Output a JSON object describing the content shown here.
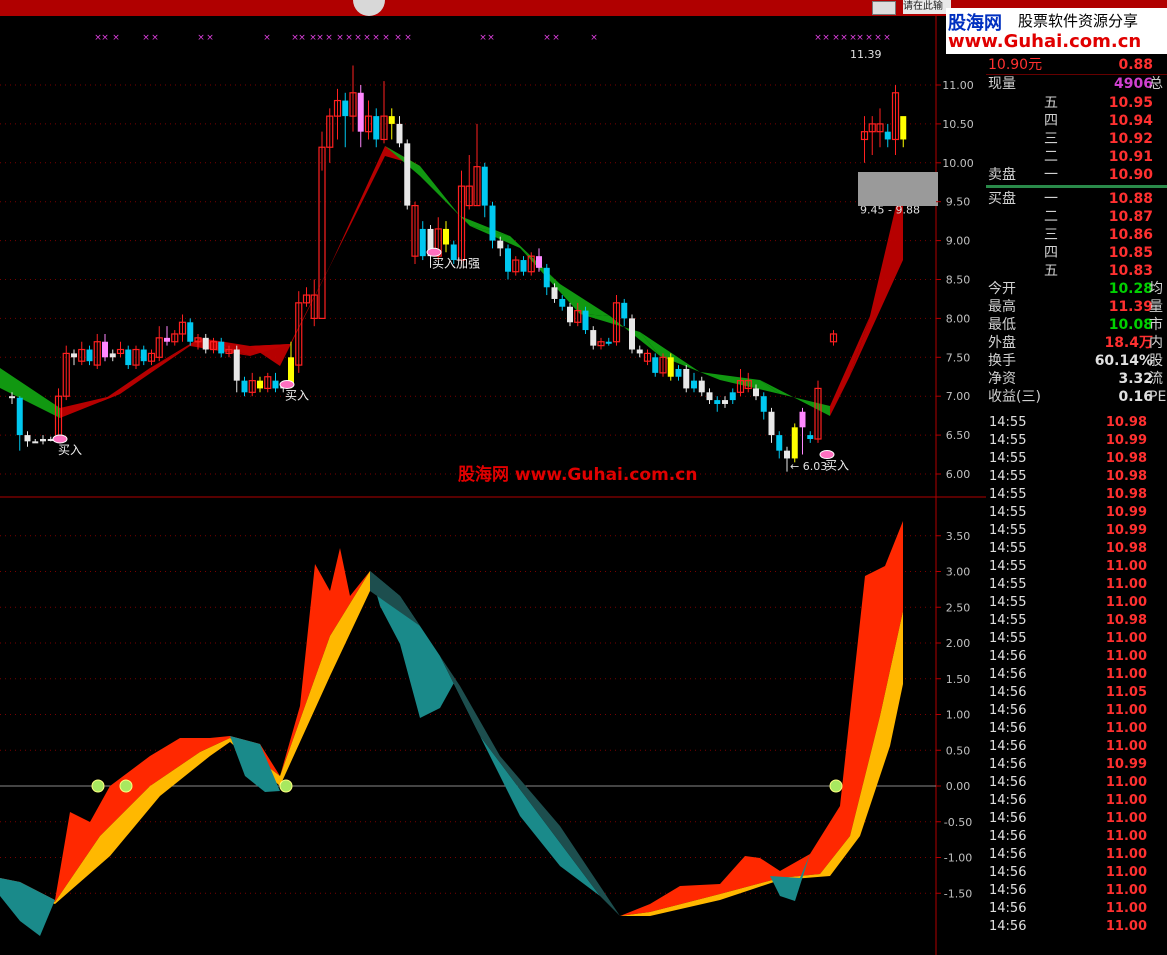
{
  "toolbar": {
    "input_text": "请在此输"
  },
  "logo": {
    "name": "股海网",
    "slogan": "股票软件资源分享",
    "url": "www.Guhai.com.cn"
  },
  "watermark": {
    "name": "股海网",
    "url": "www.Guhai.com.cn"
  },
  "quote": {
    "top_price": "10.90元",
    "top_change": "0.88",
    "volume_label": "现量",
    "volume_value": "4906",
    "volume_ext": "总",
    "sell_label": "卖盘",
    "buy_label": "买盘",
    "sell_levels": [
      {
        "label": "五",
        "price": "10.95"
      },
      {
        "label": "四",
        "price": "10.94"
      },
      {
        "label": "三",
        "price": "10.92"
      },
      {
        "label": "二",
        "price": "10.91"
      },
      {
        "label": "一",
        "price": "10.90"
      }
    ],
    "buy_levels": [
      {
        "label": "一",
        "price": "10.88"
      },
      {
        "label": "二",
        "price": "10.87"
      },
      {
        "label": "三",
        "price": "10.86"
      },
      {
        "label": "四",
        "price": "10.85"
      },
      {
        "label": "五",
        "price": "10.83"
      }
    ],
    "stats": [
      {
        "label": "今开",
        "value": "10.28",
        "cls": "green",
        "ext": "均"
      },
      {
        "label": "最高",
        "value": "11.39",
        "cls": "red",
        "ext": "量"
      },
      {
        "label": "最低",
        "value": "10.08",
        "cls": "green",
        "ext": "市"
      },
      {
        "label": "外盘",
        "value": "18.4万",
        "cls": "red",
        "ext": "内"
      },
      {
        "label": "换手",
        "value": "60.14%",
        "cls": "white",
        "ext": "股"
      },
      {
        "label": "净资",
        "value": "3.32",
        "cls": "white",
        "ext": "流"
      },
      {
        "label": "收益(三)",
        "value": "0.16",
        "cls": "white",
        "ext": "PE"
      }
    ],
    "ticks": [
      {
        "time": "14:55",
        "price": "10.98"
      },
      {
        "time": "14:55",
        "price": "10.99"
      },
      {
        "time": "14:55",
        "price": "10.98"
      },
      {
        "time": "14:55",
        "price": "10.98"
      },
      {
        "time": "14:55",
        "price": "10.98"
      },
      {
        "time": "14:55",
        "price": "10.99"
      },
      {
        "time": "14:55",
        "price": "10.99"
      },
      {
        "time": "14:55",
        "price": "10.98"
      },
      {
        "time": "14:55",
        "price": "11.00"
      },
      {
        "time": "14:55",
        "price": "11.00"
      },
      {
        "time": "14:55",
        "price": "11.00"
      },
      {
        "time": "14:55",
        "price": "10.98"
      },
      {
        "time": "14:55",
        "price": "11.00"
      },
      {
        "time": "14:56",
        "price": "11.00"
      },
      {
        "time": "14:56",
        "price": "11.00"
      },
      {
        "time": "14:56",
        "price": "11.05"
      },
      {
        "time": "14:56",
        "price": "11.00"
      },
      {
        "time": "14:56",
        "price": "11.00"
      },
      {
        "time": "14:56",
        "price": "11.00"
      },
      {
        "time": "14:56",
        "price": "10.99"
      },
      {
        "time": "14:56",
        "price": "11.00"
      },
      {
        "time": "14:56",
        "price": "11.00"
      },
      {
        "time": "14:56",
        "price": "11.00"
      },
      {
        "time": "14:56",
        "price": "11.00"
      },
      {
        "time": "14:56",
        "price": "11.00"
      },
      {
        "time": "14:56",
        "price": "11.00"
      },
      {
        "time": "14:56",
        "price": "11.00"
      },
      {
        "time": "14:56",
        "price": "11.00"
      },
      {
        "time": "14:56",
        "price": "11.00"
      }
    ]
  },
  "chart_data": [
    {
      "type": "candlestick",
      "ylim": [
        5.8,
        11.4
      ],
      "yticks": [
        "11.00",
        "10.50",
        "10.00",
        "9.50",
        "9.00",
        "8.50",
        "8.00",
        "7.50",
        "7.00",
        "6.50",
        "6.00"
      ],
      "candles": [
        [
          7.0,
          6.98,
          7.05,
          6.9,
          "w"
        ],
        [
          6.98,
          6.5,
          7.0,
          6.3,
          "c"
        ],
        [
          6.5,
          6.42,
          6.55,
          6.35,
          "w"
        ],
        [
          6.42,
          6.42,
          6.45,
          6.4,
          "w"
        ],
        [
          6.42,
          6.45,
          6.5,
          6.38,
          "w"
        ],
        [
          6.45,
          6.45,
          6.48,
          6.42,
          "w"
        ],
        [
          6.42,
          7.0,
          7.1,
          6.4,
          "r"
        ],
        [
          7.0,
          7.55,
          7.65,
          6.95,
          "r"
        ],
        [
          7.55,
          7.5,
          7.6,
          7.4,
          "w"
        ],
        [
          7.45,
          7.6,
          7.7,
          7.4,
          "r"
        ],
        [
          7.6,
          7.45,
          7.65,
          7.4,
          "c"
        ],
        [
          7.4,
          7.7,
          7.8,
          7.35,
          "r"
        ],
        [
          7.7,
          7.5,
          7.8,
          7.45,
          "p"
        ],
        [
          7.5,
          7.55,
          7.6,
          7.45,
          "w"
        ],
        [
          7.55,
          7.6,
          7.7,
          7.5,
          "r"
        ],
        [
          7.6,
          7.4,
          7.65,
          7.35,
          "c"
        ],
        [
          7.4,
          7.6,
          7.65,
          7.35,
          "r"
        ],
        [
          7.6,
          7.45,
          7.65,
          7.4,
          "c"
        ],
        [
          7.45,
          7.55,
          7.6,
          7.4,
          "r"
        ],
        [
          7.5,
          7.75,
          7.9,
          7.45,
          "r"
        ],
        [
          7.75,
          7.7,
          7.9,
          7.65,
          "p"
        ],
        [
          7.7,
          7.8,
          7.85,
          7.65,
          "r"
        ],
        [
          7.8,
          7.95,
          8.05,
          7.7,
          "r"
        ],
        [
          7.95,
          7.7,
          8.0,
          7.65,
          "c"
        ],
        [
          7.7,
          7.75,
          7.8,
          7.6,
          "r"
        ],
        [
          7.75,
          7.6,
          7.8,
          7.55,
          "w"
        ],
        [
          7.6,
          7.7,
          7.75,
          7.55,
          "r"
        ],
        [
          7.7,
          7.55,
          7.75,
          7.5,
          "c"
        ],
        [
          7.55,
          7.6,
          7.65,
          7.5,
          "r"
        ],
        [
          7.6,
          7.2,
          7.65,
          7.05,
          "w"
        ],
        [
          7.2,
          7.05,
          7.25,
          7.0,
          "c"
        ],
        [
          7.05,
          7.2,
          7.3,
          7.0,
          "r"
        ],
        [
          7.2,
          7.1,
          7.25,
          7.05,
          "y"
        ],
        [
          7.1,
          7.25,
          7.3,
          7.05,
          "r"
        ],
        [
          7.2,
          7.1,
          7.3,
          7.05,
          "c"
        ],
        [
          7.1,
          7.15,
          7.2,
          7.05,
          "w"
        ],
        [
          7.15,
          7.5,
          7.7,
          7.1,
          "y"
        ],
        [
          7.4,
          8.2,
          8.35,
          7.3,
          "r"
        ],
        [
          8.2,
          8.3,
          8.4,
          8.15,
          "r"
        ],
        [
          8.3,
          8.0,
          8.5,
          7.9,
          "r"
        ],
        [
          8.0,
          10.2,
          10.4,
          9.9,
          "r"
        ],
        [
          10.2,
          10.6,
          10.7,
          10.0,
          "r"
        ],
        [
          10.6,
          10.8,
          10.95,
          10.3,
          "r"
        ],
        [
          10.8,
          10.6,
          10.9,
          10.2,
          "c"
        ],
        [
          10.6,
          10.9,
          11.25,
          10.4,
          "r"
        ],
        [
          10.9,
          10.4,
          11.0,
          10.2,
          "p"
        ],
        [
          10.4,
          10.6,
          10.8,
          10.3,
          "r"
        ],
        [
          10.6,
          10.3,
          10.7,
          10.2,
          "c"
        ],
        [
          10.3,
          10.6,
          11.05,
          10.25,
          "r"
        ],
        [
          10.6,
          10.5,
          10.7,
          10.3,
          "y"
        ],
        [
          10.5,
          10.25,
          10.6,
          10.2,
          "w"
        ],
        [
          10.25,
          9.45,
          10.3,
          9.4,
          "w"
        ],
        [
          9.45,
          8.8,
          9.5,
          8.7,
          "r"
        ],
        [
          8.8,
          9.15,
          9.25,
          8.75,
          "c"
        ],
        [
          9.15,
          8.8,
          9.2,
          8.65,
          "w"
        ],
        [
          8.8,
          9.15,
          9.3,
          8.75,
          "r"
        ],
        [
          9.15,
          8.95,
          9.25,
          8.85,
          "y"
        ],
        [
          8.95,
          8.75,
          9.0,
          8.7,
          "c"
        ],
        [
          8.75,
          9.7,
          9.9,
          8.7,
          "r"
        ],
        [
          9.7,
          9.45,
          10.1,
          9.4,
          "r"
        ],
        [
          9.45,
          9.95,
          10.5,
          9.45,
          "r"
        ],
        [
          9.95,
          9.45,
          10.0,
          9.3,
          "c"
        ],
        [
          9.45,
          9.0,
          9.5,
          8.9,
          "c"
        ],
        [
          9.0,
          8.9,
          9.05,
          8.8,
          "w"
        ],
        [
          8.9,
          8.6,
          8.95,
          8.5,
          "c"
        ],
        [
          8.6,
          8.75,
          8.8,
          8.55,
          "r"
        ],
        [
          8.75,
          8.6,
          8.8,
          8.55,
          "c"
        ],
        [
          8.6,
          8.8,
          8.85,
          8.55,
          "r"
        ],
        [
          8.8,
          8.65,
          8.9,
          8.6,
          "p"
        ],
        [
          8.65,
          8.4,
          8.7,
          8.3,
          "c"
        ],
        [
          8.4,
          8.25,
          8.45,
          8.2,
          "w"
        ],
        [
          8.25,
          8.15,
          8.3,
          8.1,
          "c"
        ],
        [
          8.15,
          7.95,
          8.2,
          7.9,
          "w"
        ],
        [
          7.95,
          8.1,
          8.2,
          7.9,
          "r"
        ],
        [
          8.1,
          7.85,
          8.15,
          7.8,
          "c"
        ],
        [
          7.85,
          7.65,
          7.9,
          7.6,
          "w"
        ],
        [
          7.65,
          7.7,
          7.75,
          7.6,
          "r"
        ],
        [
          7.7,
          7.7,
          7.75,
          7.65,
          "c"
        ],
        [
          7.7,
          8.2,
          8.3,
          7.65,
          "r"
        ],
        [
          8.2,
          8.0,
          8.25,
          7.9,
          "c"
        ],
        [
          8.0,
          7.6,
          8.05,
          7.55,
          "w"
        ],
        [
          7.6,
          7.55,
          7.65,
          7.5,
          "w"
        ],
        [
          7.55,
          7.45,
          7.6,
          7.4,
          "r"
        ],
        [
          7.5,
          7.3,
          7.55,
          7.25,
          "c"
        ],
        [
          7.3,
          7.5,
          7.55,
          7.25,
          "r"
        ],
        [
          7.5,
          7.25,
          7.55,
          7.2,
          "y"
        ],
        [
          7.25,
          7.35,
          7.4,
          7.2,
          "c"
        ],
        [
          7.35,
          7.1,
          7.4,
          7.05,
          "w"
        ],
        [
          7.1,
          7.2,
          7.3,
          7.05,
          "c"
        ],
        [
          7.2,
          7.05,
          7.25,
          7.0,
          "w"
        ],
        [
          7.05,
          6.95,
          7.1,
          6.9,
          "w"
        ],
        [
          6.95,
          6.9,
          7.0,
          6.8,
          "c"
        ],
        [
          6.9,
          6.95,
          7.0,
          6.85,
          "w"
        ],
        [
          6.95,
          7.05,
          7.1,
          6.9,
          "c"
        ],
        [
          7.05,
          7.2,
          7.35,
          7.0,
          "r"
        ],
        [
          7.2,
          7.1,
          7.3,
          7.05,
          "r"
        ],
        [
          7.1,
          7.0,
          7.15,
          6.95,
          "w"
        ],
        [
          7.0,
          6.8,
          7.05,
          6.7,
          "c"
        ],
        [
          6.8,
          6.5,
          6.85,
          6.4,
          "w"
        ],
        [
          6.5,
          6.3,
          6.55,
          6.2,
          "c"
        ],
        [
          6.3,
          6.2,
          6.35,
          6.03,
          "w"
        ],
        [
          6.2,
          6.6,
          6.65,
          6.15,
          "y"
        ],
        [
          6.6,
          6.8,
          6.85,
          6.25,
          "p"
        ],
        [
          6.5,
          6.45,
          6.55,
          6.4,
          "c"
        ],
        [
          6.45,
          7.1,
          7.2,
          6.4,
          "r"
        ],
        null,
        [
          7.7,
          7.8,
          7.85,
          7.65,
          "r"
        ],
        null,
        null,
        null,
        [
          10.3,
          10.4,
          10.6,
          10.0,
          "r"
        ],
        [
          10.4,
          10.5,
          10.6,
          10.1,
          "r"
        ],
        [
          10.5,
          10.4,
          10.7,
          10.2,
          "r"
        ],
        [
          10.4,
          10.3,
          10.5,
          10.2,
          "c"
        ],
        [
          10.3,
          10.9,
          11.0,
          10.1,
          "r"
        ],
        [
          10.6,
          10.3,
          10.5,
          10.2,
          "y"
        ]
      ],
      "markers": [
        {
          "label": "买入",
          "x": 60,
          "y": 6.45
        },
        {
          "label": "买入",
          "x": 287,
          "y": 7.15
        },
        {
          "label": "买入加强",
          "x": 434,
          "y": 8.85
        },
        {
          "label": "买入",
          "x": 827,
          "y": 6.25
        }
      ],
      "annotations": [
        {
          "text": "11.39",
          "x": 850,
          "y": 11.35
        },
        {
          "text": "9.45 - 9.88",
          "x": 860,
          "y": 9.35
        },
        {
          "text": "← 6.03",
          "x": 790,
          "y": 6.05
        }
      ],
      "x_signals": [
        98,
        105,
        116,
        146,
        155,
        201,
        210,
        267,
        295,
        302,
        313,
        320,
        329,
        340,
        349,
        358,
        367,
        376,
        386,
        398,
        408,
        483,
        491,
        547,
        556,
        594,
        818,
        826,
        836,
        844,
        853,
        860,
        869,
        878,
        887
      ]
    },
    {
      "type": "area",
      "ylim": [
        -2.1,
        3.8
      ],
      "yticks": [
        "3.50",
        "3.00",
        "2.50",
        "2.00",
        "1.50",
        "1.00",
        "0.50",
        "0.00",
        "-0.50",
        "-1.00",
        "-1.50"
      ],
      "signal_points": [
        98,
        126,
        286,
        836
      ]
    }
  ]
}
